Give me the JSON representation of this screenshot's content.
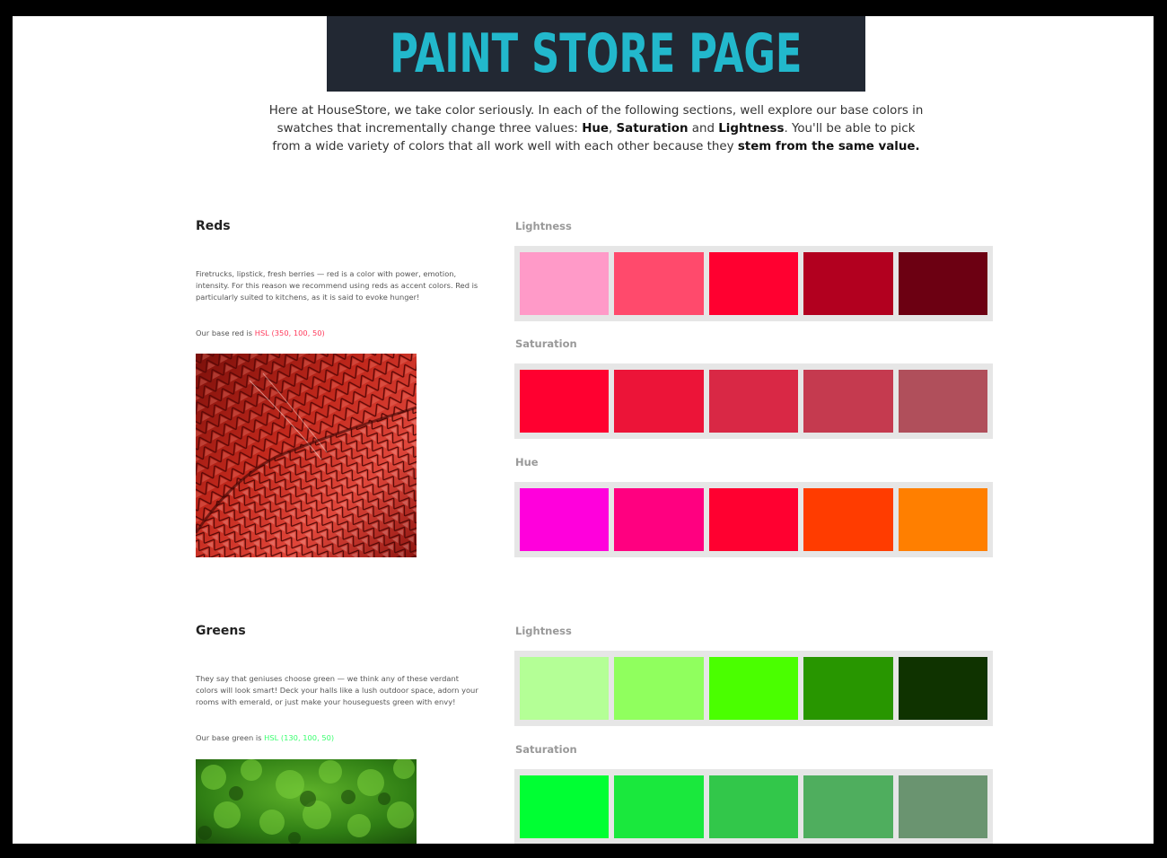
{
  "banner": {
    "title": "PAINT STORE PAGE"
  },
  "intro": {
    "text1": "Here at HouseStore, we take color seriously. In each of the following sections, well explore our base colors in swatches that incrementally change three values: ",
    "hue": "Hue",
    "comma": ", ",
    "saturation": "Saturation",
    "and": " and ",
    "lightness": "Lightness",
    "text2": ". You'll be able to pick from a wide variety of colors that all work well with each other because they ",
    "stem": "stem from the same value."
  },
  "reds": {
    "title": "Reds",
    "description": "Firetrucks, lipstick, fresh berries — red is a color with power, emotion, intensity. For this reason we recommend using reds as accent colors. Red is particularly suited to kitchens, as it is said to evoke hunger!",
    "base_prefix": "Our base red is ",
    "base_value": "HSL (350, 100, 50)",
    "lightness_label": "Lightness",
    "saturation_label": "Saturation",
    "hue_label": "Hue",
    "lightness": [
      "#ff9ac8",
      "#ff4a6c",
      "#ff0030",
      "#b2001f",
      "#6c0012"
    ],
    "saturation": [
      "#ff0030",
      "#ec1438",
      "#d92845",
      "#c53a4f",
      "#b04f5b"
    ],
    "hue": [
      "#ff00dc",
      "#ff0080",
      "#ff0030",
      "#ff3c00",
      "#ff7f00"
    ]
  },
  "greens": {
    "title": "Greens",
    "description": "They say that geniuses choose green — we think any of these verdant colors will look smart! Deck your halls like a lush outdoor space, adorn your rooms with emerald, or just make your houseguests green with envy!",
    "base_prefix": "Our base green is ",
    "base_value": "HSL (130, 100, 50)",
    "lightness_label": "Lightness",
    "saturation_label": "Saturation",
    "lightness": [
      "#b4ff96",
      "#90ff5e",
      "#4aff00",
      "#289600",
      "#0f3300"
    ],
    "saturation": [
      "#00ff33",
      "#1ae83d",
      "#32c74a",
      "#4fae5e",
      "#6a9470"
    ]
  }
}
